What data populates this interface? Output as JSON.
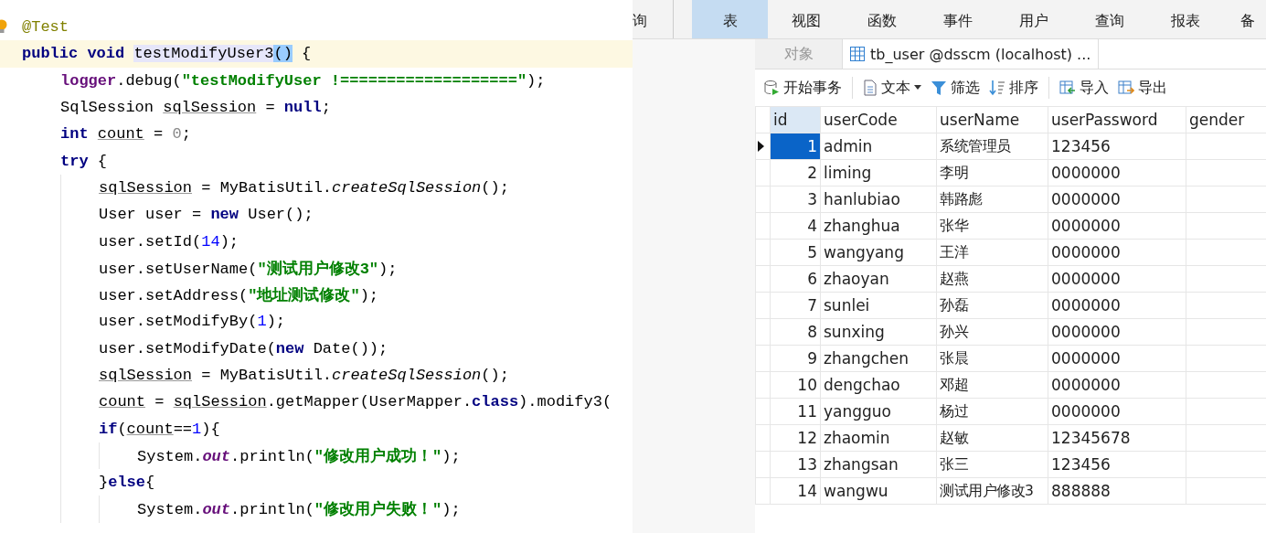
{
  "editor": {
    "lines": [
      {
        "bulb": true,
        "current": false,
        "tokens": [
          {
            "kind": "annotation",
            "t": "@Test"
          }
        ]
      },
      {
        "bulb": false,
        "current": true,
        "tokens": [
          {
            "kind": "kw",
            "t": "public void "
          },
          {
            "kind": "highlight",
            "t": "testModifyUser3"
          },
          {
            "kind": "paren",
            "t": "()"
          },
          {
            "kind": "plain",
            "t": " {"
          }
        ],
        "children": [
          {
            "bulb": false,
            "current": false,
            "tokens": [
              {
                "kind": "field",
                "t": "logger"
              },
              {
                "kind": "plain",
                "t": ".debug("
              },
              {
                "kind": "str",
                "t": "\"testModifyUser !===================\""
              },
              {
                "kind": "plain",
                "t": ");"
              }
            ]
          },
          {
            "bulb": false,
            "current": false,
            "tokens": [
              {
                "kind": "plain",
                "t": "SqlSession "
              },
              {
                "kind": "var",
                "t": "sqlSession"
              },
              {
                "kind": "plain",
                "t": " = "
              },
              {
                "kind": "kw",
                "t": "null"
              },
              {
                "kind": "plain",
                "t": ";"
              }
            ]
          },
          {
            "bulb": false,
            "current": false,
            "tokens": [
              {
                "kind": "kw",
                "t": "int "
              },
              {
                "kind": "var",
                "t": "count"
              },
              {
                "kind": "plain",
                "t": " = "
              },
              {
                "kind": "zero",
                "t": "0"
              },
              {
                "kind": "plain",
                "t": ";"
              }
            ]
          },
          {
            "bulb": false,
            "current": false,
            "tokens": [
              {
                "kind": "kw",
                "t": "try"
              },
              {
                "kind": "plain",
                "t": " {"
              }
            ],
            "children": [
              {
                "bulb": false,
                "current": false,
                "tokens": [
                  {
                    "kind": "var",
                    "t": "sqlSession"
                  },
                  {
                    "kind": "plain",
                    "t": " = MyBatisUtil."
                  },
                  {
                    "kind": "static",
                    "t": "createSqlSession"
                  },
                  {
                    "kind": "plain",
                    "t": "();"
                  }
                ]
              },
              {
                "bulb": false,
                "current": false,
                "tokens": [
                  {
                    "kind": "plain",
                    "t": "User user = "
                  },
                  {
                    "kind": "kw",
                    "t": "new"
                  },
                  {
                    "kind": "plain",
                    "t": " User();"
                  }
                ]
              },
              {
                "bulb": false,
                "current": false,
                "tokens": [
                  {
                    "kind": "plain",
                    "t": "user.setId("
                  },
                  {
                    "kind": "num",
                    "t": "14"
                  },
                  {
                    "kind": "plain",
                    "t": ");"
                  }
                ]
              },
              {
                "bulb": false,
                "current": false,
                "tokens": [
                  {
                    "kind": "plain",
                    "t": "user.setUserName("
                  },
                  {
                    "kind": "str",
                    "t": "\"测试用户修改3\""
                  },
                  {
                    "kind": "plain",
                    "t": ");"
                  }
                ]
              },
              {
                "bulb": false,
                "current": false,
                "tokens": [
                  {
                    "kind": "plain",
                    "t": "user.setAddress("
                  },
                  {
                    "kind": "str",
                    "t": "\"地址测试修改\""
                  },
                  {
                    "kind": "plain",
                    "t": ");"
                  }
                ]
              },
              {
                "bulb": false,
                "current": false,
                "tokens": [
                  {
                    "kind": "plain",
                    "t": "user.setModifyBy("
                  },
                  {
                    "kind": "num",
                    "t": "1"
                  },
                  {
                    "kind": "plain",
                    "t": ");"
                  }
                ]
              },
              {
                "bulb": false,
                "current": false,
                "tokens": [
                  {
                    "kind": "plain",
                    "t": "user.setModifyDate("
                  },
                  {
                    "kind": "kw",
                    "t": "new"
                  },
                  {
                    "kind": "plain",
                    "t": " Date());"
                  }
                ]
              },
              {
                "bulb": false,
                "current": false,
                "tokens": [
                  {
                    "kind": "var",
                    "t": "sqlSession"
                  },
                  {
                    "kind": "plain",
                    "t": " = MyBatisUtil."
                  },
                  {
                    "kind": "static",
                    "t": "createSqlSession"
                  },
                  {
                    "kind": "plain",
                    "t": "();"
                  }
                ]
              },
              {
                "bulb": false,
                "current": false,
                "tokens": [
                  {
                    "kind": "var",
                    "t": "count"
                  },
                  {
                    "kind": "plain",
                    "t": " = "
                  },
                  {
                    "kind": "var",
                    "t": "sqlSession"
                  },
                  {
                    "kind": "plain",
                    "t": ".getMapper(UserMapper."
                  },
                  {
                    "kind": "kw",
                    "t": "class"
                  },
                  {
                    "kind": "plain",
                    "t": ").modify3("
                  }
                ]
              },
              {
                "bulb": false,
                "current": false,
                "tokens": [
                  {
                    "kind": "kw",
                    "t": "if"
                  },
                  {
                    "kind": "plain",
                    "t": "("
                  },
                  {
                    "kind": "var",
                    "t": "count"
                  },
                  {
                    "kind": "plain",
                    "t": "=="
                  },
                  {
                    "kind": "num",
                    "t": "1"
                  },
                  {
                    "kind": "plain",
                    "t": "){"
                  }
                ],
                "children": [
                  {
                    "bulb": false,
                    "current": false,
                    "tokens": [
                      {
                        "kind": "plain",
                        "t": "System."
                      },
                      {
                        "kind": "field",
                        "t": "out"
                      },
                      {
                        "kind": "plain",
                        "t": ".println("
                      },
                      {
                        "kind": "str",
                        "t": "\"修改用户成功！\""
                      },
                      {
                        "kind": "plain",
                        "t": ");"
                      }
                    ]
                  }
                ]
              },
              {
                "bulb": false,
                "current": false,
                "tokens": [
                  {
                    "kind": "plain",
                    "t": "}"
                  },
                  {
                    "kind": "kw",
                    "t": "else"
                  },
                  {
                    "kind": "plain",
                    "t": "{"
                  }
                ],
                "children": [
                  {
                    "bulb": false,
                    "current": false,
                    "tokens": [
                      {
                        "kind": "plain",
                        "t": "System."
                      },
                      {
                        "kind": "field",
                        "t": "out"
                      },
                      {
                        "kind": "plain",
                        "t": ".println("
                      },
                      {
                        "kind": "str",
                        "t": "\"修改用户失败！\""
                      },
                      {
                        "kind": "plain",
                        "t": ");"
                      }
                    ]
                  }
                ]
              }
            ]
          }
        ]
      }
    ]
  },
  "ribbon": {
    "tabs": [
      {
        "label": "询",
        "selected": false
      },
      {
        "label": "表",
        "selected": true
      },
      {
        "label": "视图",
        "selected": false
      },
      {
        "label": "函数",
        "selected": false
      },
      {
        "label": "事件",
        "selected": false
      },
      {
        "label": "用户",
        "selected": false
      },
      {
        "label": "查询",
        "selected": false
      },
      {
        "label": "报表",
        "selected": false
      },
      {
        "label": "备",
        "selected": false
      }
    ]
  },
  "doc_tabs": [
    {
      "label": "对象",
      "selected": false,
      "kind": "plain"
    },
    {
      "label": "tb_user @dsscm (localhost) ...",
      "selected": true,
      "kind": "table"
    }
  ],
  "toolbar": [
    {
      "label": "开始事务",
      "kind": "transaction"
    },
    {
      "label": "文本",
      "kind": "text"
    },
    {
      "label": "筛选",
      "kind": "filter"
    },
    {
      "label": "排序",
      "kind": "sort"
    },
    {
      "label": "导入",
      "kind": "import"
    },
    {
      "label": "导出",
      "kind": "export"
    }
  ],
  "table": {
    "columns": [
      "id",
      "userCode",
      "userName",
      "userPassword",
      "gender"
    ],
    "rows": [
      {
        "selected": true,
        "cells": [
          "1",
          "admin",
          "系统管理员",
          "123456"
        ]
      },
      {
        "selected": false,
        "cells": [
          "2",
          "liming",
          "李明",
          "0000000"
        ]
      },
      {
        "selected": false,
        "cells": [
          "3",
          "hanlubiao",
          "韩路彪",
          "0000000"
        ]
      },
      {
        "selected": false,
        "cells": [
          "4",
          "zhanghua",
          "张华",
          "0000000"
        ]
      },
      {
        "selected": false,
        "cells": [
          "5",
          "wangyang",
          "王洋",
          "0000000"
        ]
      },
      {
        "selected": false,
        "cells": [
          "6",
          "zhaoyan",
          "赵燕",
          "0000000"
        ]
      },
      {
        "selected": false,
        "cells": [
          "7",
          "sunlei",
          "孙磊",
          "0000000"
        ]
      },
      {
        "selected": false,
        "cells": [
          "8",
          "sunxing",
          "孙兴",
          "0000000"
        ]
      },
      {
        "selected": false,
        "cells": [
          "9",
          "zhangchen",
          "张晨",
          "0000000"
        ]
      },
      {
        "selected": false,
        "cells": [
          "10",
          "dengchao",
          "邓超",
          "0000000"
        ]
      },
      {
        "selected": false,
        "cells": [
          "11",
          "yangguo",
          "杨过",
          "0000000"
        ]
      },
      {
        "selected": false,
        "cells": [
          "12",
          "zhaomin",
          "赵敏",
          "12345678"
        ]
      },
      {
        "selected": false,
        "cells": [
          "13",
          "zhangsan",
          "张三",
          "123456"
        ]
      },
      {
        "selected": false,
        "cells": [
          "14",
          "wangwu",
          "测试用户修改3",
          "888888"
        ]
      }
    ]
  }
}
